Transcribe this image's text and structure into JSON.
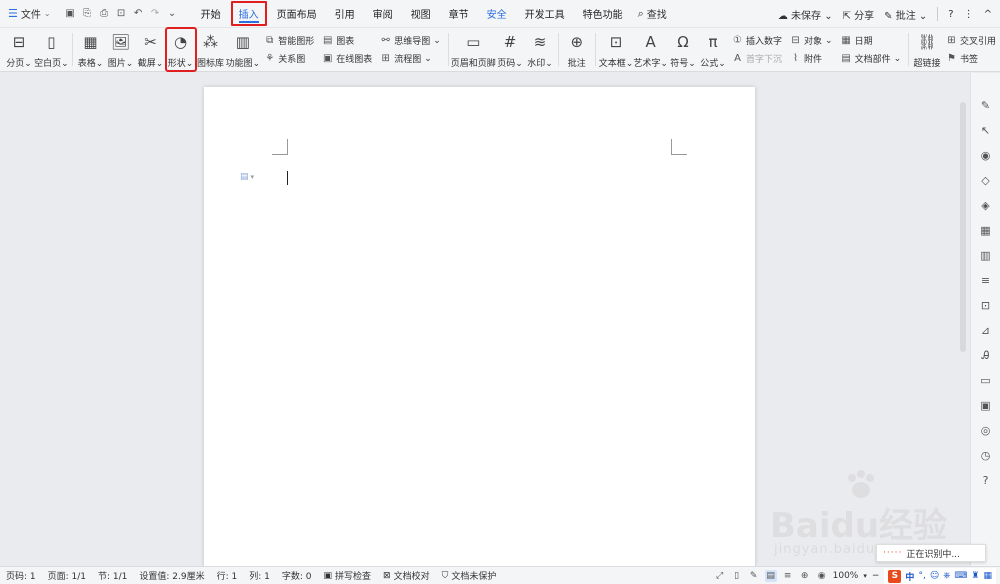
{
  "topbar": {
    "file_label": "文件",
    "tabs": [
      "开始",
      "插入",
      "页面布局",
      "引用",
      "审阅",
      "视图",
      "章节",
      "安全",
      "开发工具",
      "特色功能"
    ],
    "active_tab": "插入",
    "search_label": "查找",
    "unsaved_label": "未保存",
    "share_label": "分享",
    "annotate_label": "批注",
    "help_label": "?",
    "more_label": "⋮",
    "close_label": "^"
  },
  "ribbon": {
    "page_break": "分页",
    "blank_page": "空白页",
    "table": "表格",
    "picture": "图片",
    "screenshot": "截屏",
    "shape": "形状",
    "icon_lib": "图标库",
    "func_chart": "功能图",
    "smart_art": "智能图形",
    "relation": "关系图",
    "chart": "图表",
    "online_chart": "在线图表",
    "mind_map": "思维导图",
    "flow_chart": "流程图",
    "header_footer": "页眉和页脚",
    "page_number": "页码",
    "watermark": "水印",
    "comment": "批注",
    "textbox": "文本框",
    "art_text": "艺术字",
    "symbol": "符号",
    "formula": "公式",
    "insert_number": "插入数字",
    "drop_cap": "首字下沉",
    "object": "对象",
    "attachment": "附件",
    "date": "日期",
    "doc_part": "文档部件",
    "hyperlink": "超链接",
    "cross_ref": "交叉引用",
    "bookmark": "书签"
  },
  "status": {
    "page_num": "页码: 1",
    "page": "页面: 1/1",
    "section": "节: 1/1",
    "position": "设置值: 2.9厘米",
    "row": "行: 1",
    "col": "列: 1",
    "words": "字数: 0",
    "spell": "拼写检查",
    "proof": "文档校对",
    "protect": "文档未保护",
    "zoom": "100%"
  },
  "popup": {
    "text": "正在识别中..."
  },
  "watermark": {
    "main": "Baidu经验",
    "sub": "jingyan.baidu.com"
  },
  "ime": {
    "logo": "S",
    "lang": "中"
  },
  "colors": {
    "accent": "#2a6ee0",
    "highlight": "#e02020"
  }
}
